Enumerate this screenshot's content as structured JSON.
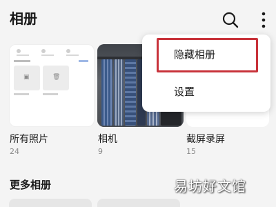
{
  "header": {
    "title": "相册",
    "search_icon": "search-icon",
    "more_icon": "more-vertical-icon"
  },
  "albums": [
    {
      "name": "所有照片",
      "count": "24"
    },
    {
      "name": "相机",
      "count": "9"
    },
    {
      "name": "截屏录屏",
      "count": "15"
    }
  ],
  "section": {
    "title": "更多相册"
  },
  "menu": {
    "items": [
      {
        "label": "隐藏相册"
      },
      {
        "label": "设置"
      }
    ],
    "highlight_color": "#c8323a"
  },
  "watermark": "易坊好文馆"
}
